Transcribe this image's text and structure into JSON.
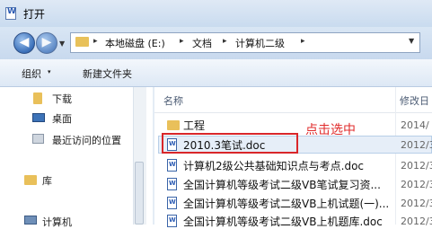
{
  "window": {
    "title": "打开"
  },
  "nav": {
    "back": "◀",
    "forward": "▶"
  },
  "address": {
    "crumbs": [
      "本地磁盘 (E:)",
      "文档",
      "计算机二级"
    ],
    "separators": [
      "▸",
      "▸",
      "▸",
      "▸"
    ]
  },
  "toolbar": {
    "organize": "组织",
    "organize_arrow": "▾",
    "new_folder": "新建文件夹"
  },
  "sidebar": {
    "items": [
      {
        "label": "下载",
        "icon": "download-folder-icon"
      },
      {
        "label": "桌面",
        "icon": "desktop-icon"
      },
      {
        "label": "最近访问的位置",
        "icon": "recent-places-icon"
      },
      {
        "label": "库",
        "icon": "libraries-icon"
      },
      {
        "label": "计算机",
        "icon": "computer-icon"
      }
    ]
  },
  "columns": {
    "name": "名称",
    "date": "修改日"
  },
  "files": [
    {
      "name": "工程",
      "date": "2014/",
      "type": "folder"
    },
    {
      "name": "2010.3笔试.doc",
      "date": "2012/3",
      "type": "doc",
      "selected": true
    },
    {
      "name": "计算机2级公共基础知识点与考点.doc",
      "date": "2012/3",
      "type": "doc"
    },
    {
      "name": "全国计算机等级考试二级VB笔试复习资...",
      "date": "2012/3",
      "type": "doc"
    },
    {
      "name": "全国计算机等级考试二级VB上机试题(一)...",
      "date": "2012/3",
      "type": "doc"
    },
    {
      "name": "全国计算机等级考试二级VB上机题库.doc",
      "date": "2012/3",
      "type": "doc"
    }
  ],
  "annotation": {
    "text": "点击选中",
    "color": "#e02c2c"
  }
}
